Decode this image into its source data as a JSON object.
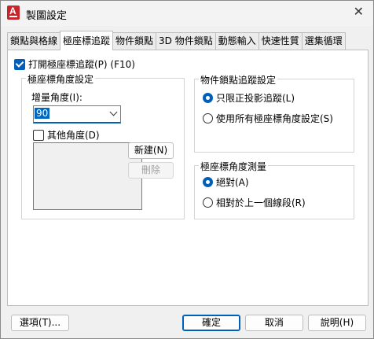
{
  "window": {
    "title": "製圖設定",
    "close": "✕"
  },
  "tabs": [
    {
      "label": "鎖點與格線",
      "active": false
    },
    {
      "label": "極座標追蹤",
      "active": true
    },
    {
      "label": "物件鎖點",
      "active": false
    },
    {
      "label": "3D 物件鎖點",
      "active": false
    },
    {
      "label": "動態輸入",
      "active": false
    },
    {
      "label": "快速性質",
      "active": false
    },
    {
      "label": "選集循環",
      "active": false
    }
  ],
  "polar": {
    "enable_label": "打開極座標追蹤(P) (F10)",
    "enable_checked": true,
    "angle_settings": {
      "group_title": "極座標角度設定",
      "increment_label": "增量角度(I):",
      "increment_value": "90",
      "additional_label": "其他角度(D)",
      "additional_checked": false,
      "new_button": "新建(N)",
      "delete_button": "刪除"
    },
    "osnap_tracking": {
      "group_title": "物件鎖點追蹤設定",
      "options": [
        "只限正投影追蹤(L)",
        "使用所有極座標角度設定(S)"
      ],
      "selected": 0
    },
    "measurement": {
      "group_title": "極座標角度測量",
      "options": [
        "絕對(A)",
        "相對於上一個線段(R)"
      ],
      "selected": 0
    }
  },
  "footer": {
    "options_button": "選項(T)...",
    "ok_button": "確定",
    "cancel_button": "取消",
    "help_button": "說明(H)"
  },
  "colors": {
    "accent": "#005fb8",
    "app_icon": "#c7252c"
  }
}
